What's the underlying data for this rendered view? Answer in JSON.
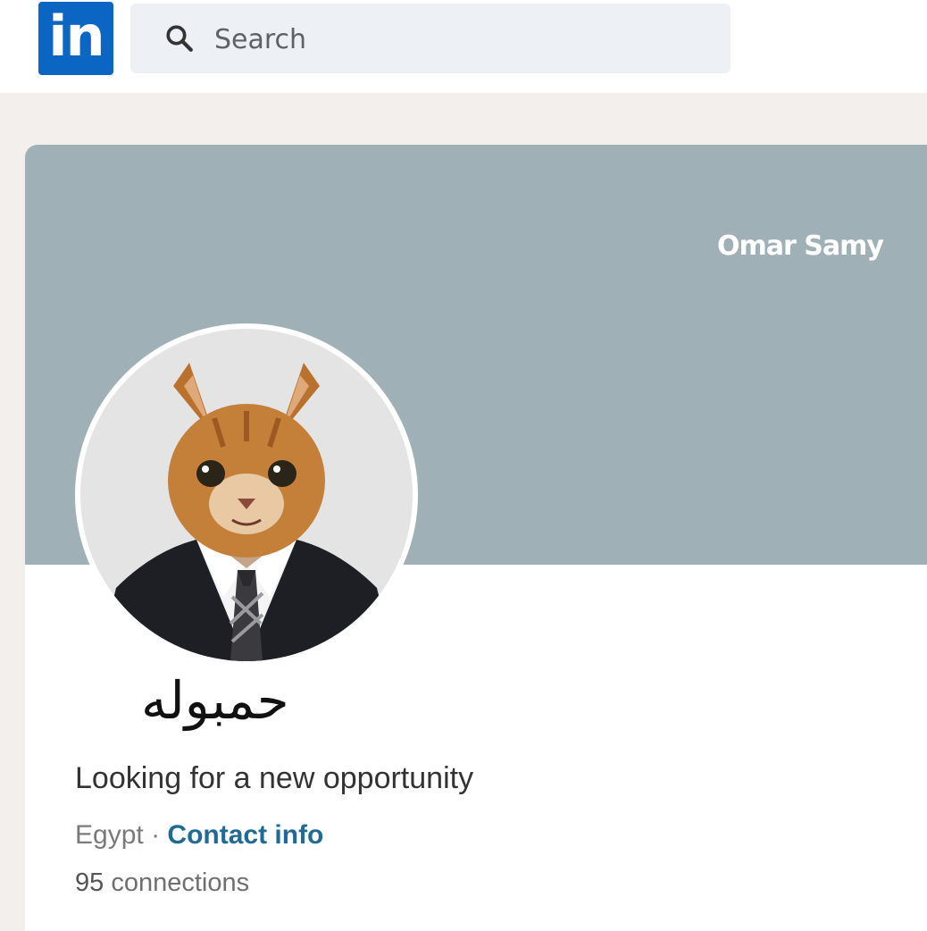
{
  "header": {
    "logo_text": "in",
    "search": {
      "placeholder": "Search",
      "icon": "search-icon"
    }
  },
  "colors": {
    "brand": "#0a66c2",
    "cover": "#9fb1b7",
    "link": "#1f6b93"
  },
  "profile": {
    "cover_text": "Omar Samy",
    "name": "حمبوله",
    "headline": "Looking for a new opportunity",
    "location": "Egypt",
    "separator": "·",
    "contact_label": "Contact info",
    "connections_count": "95",
    "connections_label": "connections"
  }
}
